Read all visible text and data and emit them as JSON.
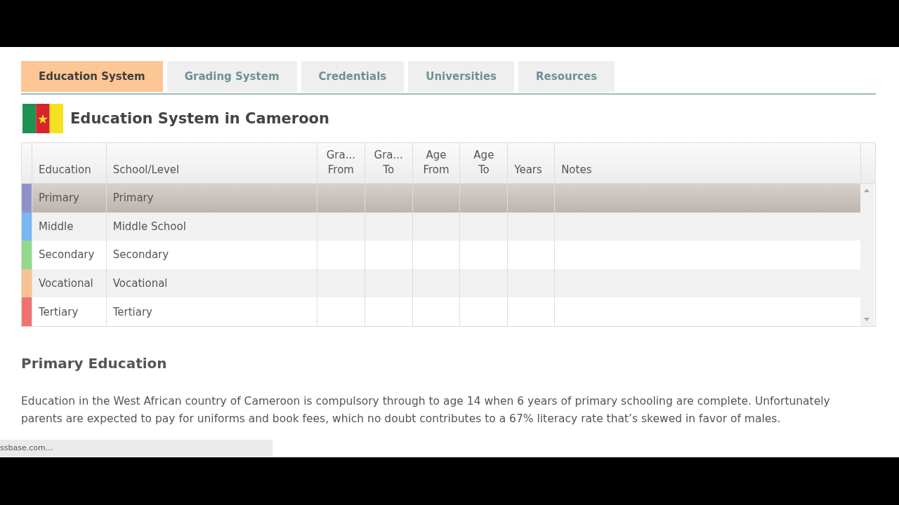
{
  "tabs": [
    {
      "label": "Education System",
      "selected": true
    },
    {
      "label": "Grading System",
      "selected": false
    },
    {
      "label": "Credentials",
      "selected": false
    },
    {
      "label": "Universities",
      "selected": false
    },
    {
      "label": "Resources",
      "selected": false
    }
  ],
  "page_title": "Education System in Cameroon",
  "table": {
    "columns": [
      {
        "lines": [
          "Education"
        ]
      },
      {
        "lines": [
          "School/Level"
        ]
      },
      {
        "lines": [
          "Gra...",
          "From"
        ]
      },
      {
        "lines": [
          "Gra...",
          "To"
        ]
      },
      {
        "lines": [
          "Age",
          "From"
        ]
      },
      {
        "lines": [
          "Age",
          "To"
        ]
      },
      {
        "lines": [
          "Years"
        ]
      },
      {
        "lines": [
          "Notes"
        ]
      }
    ],
    "rows": [
      {
        "education": "Primary",
        "school_level": "Primary",
        "color": "#9191c9",
        "selected": true
      },
      {
        "education": "Middle",
        "school_level": "Middle School",
        "color": "#7ab6f2",
        "selected": false
      },
      {
        "education": "Secondary",
        "school_level": "Secondary",
        "color": "#93d98c",
        "selected": false
      },
      {
        "education": "Vocational",
        "school_level": "Vocational",
        "color": "#f9c291",
        "selected": false
      },
      {
        "education": "Tertiary",
        "school_level": "Tertiary",
        "color": "#f27272",
        "selected": false
      }
    ]
  },
  "sections": [
    {
      "heading": "Primary Education",
      "text": "Education in the West African country of Cameroon is compulsory through to age 14 when 6 years of primary schooling are complete. Unfortunately parents are expected to pay for uniforms and book fees, which no doubt contributes to a 67% literacy rate that’s skewed in favor of males."
    }
  ],
  "status_bar": {
    "text": "ssbase.com..."
  }
}
